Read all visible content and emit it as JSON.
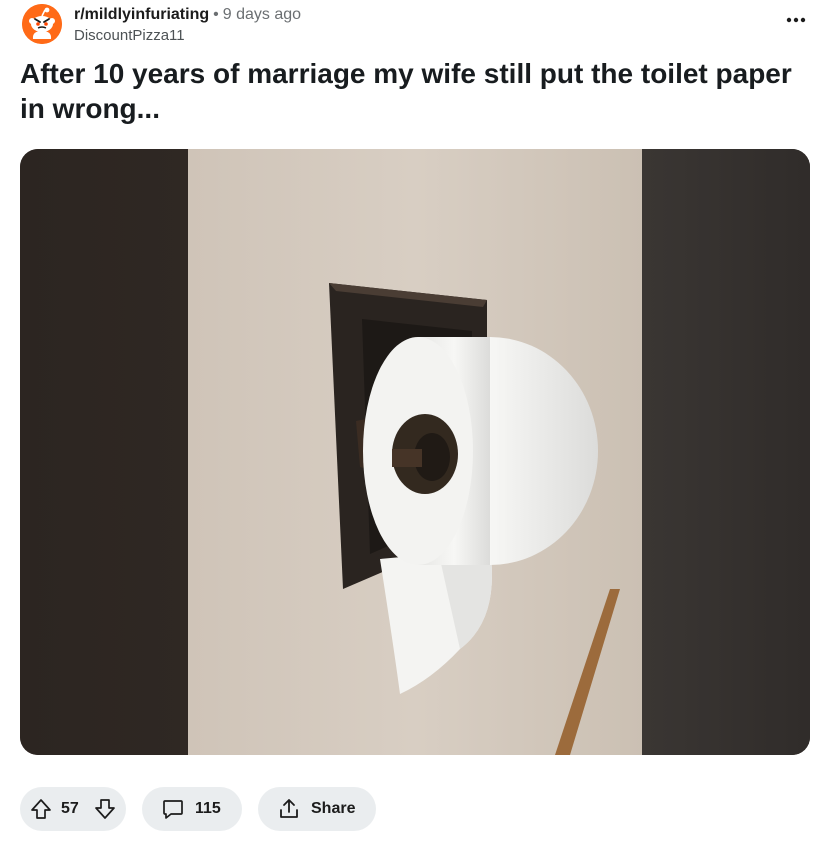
{
  "post": {
    "subreddit": "r/mildlyinfuriating",
    "separator": "•",
    "age": "9 days ago",
    "author": "DiscountPizza11",
    "title": "After 10 years of marriage my wife still put the toilet paper in wrong...",
    "avatar_icon": "reddit-snoo-icon",
    "more_icon": "more-options-icon",
    "image_icon": "toilet-paper-roll-photo"
  },
  "actions": {
    "upvote_icon": "upvote-arrow-icon",
    "score": "57",
    "downvote_icon": "downvote-arrow-icon",
    "comment_icon": "comment-bubble-icon",
    "comments_count": "115",
    "share_icon": "share-icon",
    "share_label": "Share"
  },
  "colors": {
    "avatar_bg": "#ff6a17",
    "pill_bg": "#eaedef",
    "text_primary": "#1c1c1c",
    "text_muted": "#6b6f72"
  }
}
